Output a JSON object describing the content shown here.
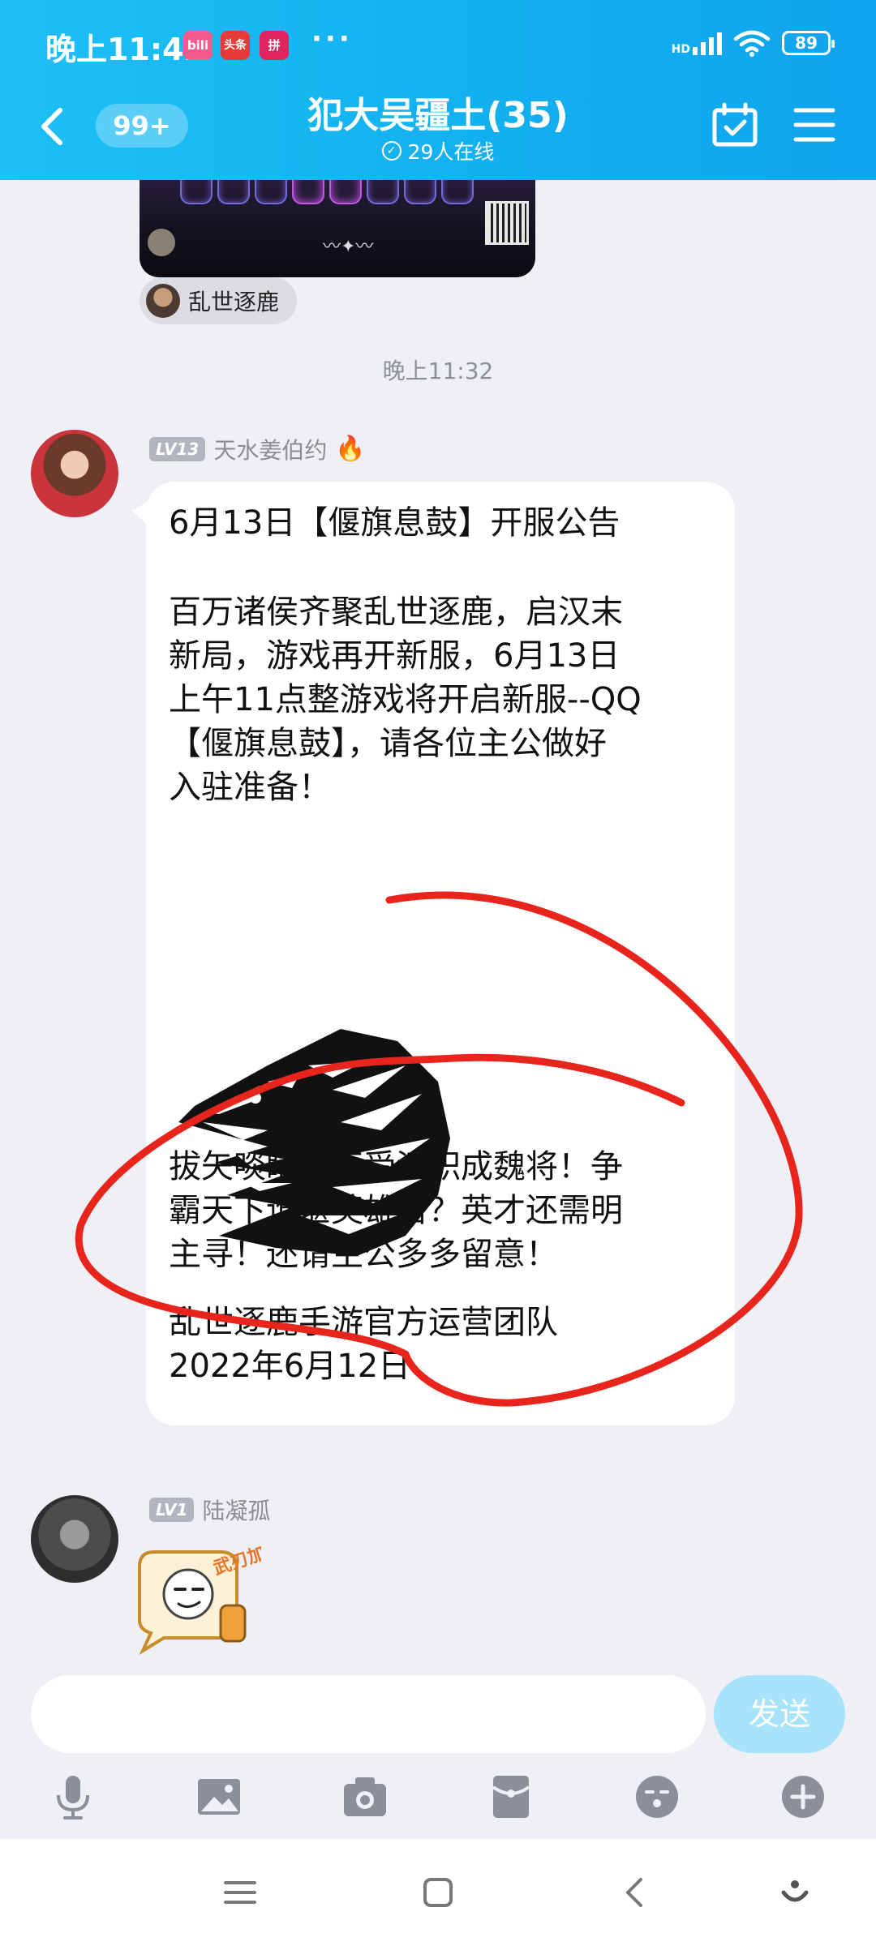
{
  "status_bar": {
    "time": "晚上11:42",
    "apps": [
      {
        "name": "bilibili",
        "label": "bili",
        "color": "#f45a8d"
      },
      {
        "name": "toutiao",
        "label": "头条",
        "color": "#e63b3b"
      },
      {
        "name": "pinduoduo",
        "label": "拼",
        "color": "#e0245e"
      }
    ],
    "dots": "···",
    "battery": "89",
    "network_label": "HD"
  },
  "header": {
    "unread_count": "99+",
    "title": "犯大吴疆土(35)",
    "online": "29人在线"
  },
  "previous_message": {
    "game_tag": "乱世逐鹿"
  },
  "timestamp": "晚上11:32",
  "messages": [
    {
      "sender": "天水姜伯约",
      "level": "LV13",
      "title": "6月13日【偃旗息鼓】开服公告",
      "body_lines": [
        "百万诸侯齐聚乱世逐鹿，启汉末",
        "新局，游戏再开新服，6月13日",
        "上午11点整游戏将开启新服--QQ",
        "【偃旗息鼓】，请各位主公做好",
        "入驻准备！"
      ],
      "slogan_lines": [
        "拔矢啖睛，不受汉职成魏将！争",
        "霸天下谁堪英雄名？英才还需明",
        "主寻！还请主公多多留意！"
      ],
      "signature_lines": [
        "乱世逐鹿手游官方运营团队",
        "2022年6月12日"
      ]
    },
    {
      "sender": "陆凝孤",
      "level": "LV1",
      "sticker": "武刃加油"
    }
  ],
  "input": {
    "value": "",
    "send_label": "发送"
  },
  "toolbar_icons": [
    "microphone-icon",
    "image-icon",
    "camera-icon",
    "red-packet-icon",
    "emoji-icon",
    "plus-icon"
  ],
  "annotation_color": "#e8251c"
}
